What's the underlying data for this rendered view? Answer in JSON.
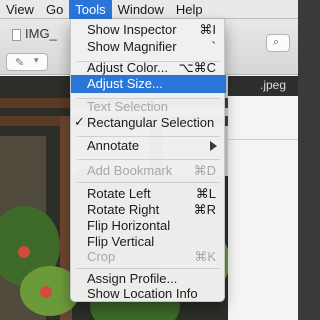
{
  "menubar": {
    "items": [
      "View",
      "Go",
      "Tools",
      "Window",
      "Help"
    ]
  },
  "window": {
    "doc_title": "IMG_",
    "side_tab": ".jpeg"
  },
  "tools_menu": {
    "items": [
      {
        "label": "Show Inspector",
        "shortcut": "⌘I"
      },
      {
        "label": "Show Magnifier",
        "shortcut": "`"
      },
      {
        "label": "Adjust Color...",
        "shortcut": "⌥⌘C"
      },
      {
        "label": "Adjust Size...",
        "shortcut": ""
      },
      {
        "label": "Text Selection",
        "shortcut": ""
      },
      {
        "label": "Rectangular Selection",
        "shortcut": "",
        "check": "✓"
      },
      {
        "label": "Annotate",
        "shortcut": ""
      },
      {
        "label": "Add Bookmark",
        "shortcut": "⌘D"
      },
      {
        "label": "Rotate Left",
        "shortcut": "⌘L"
      },
      {
        "label": "Rotate Right",
        "shortcut": "⌘R"
      },
      {
        "label": "Flip Horizontal",
        "shortcut": ""
      },
      {
        "label": "Flip Vertical",
        "shortcut": ""
      },
      {
        "label": "Crop",
        "shortcut": "⌘K"
      },
      {
        "label": "Assign Profile...",
        "shortcut": ""
      },
      {
        "label": "Show Location Info",
        "shortcut": ""
      }
    ]
  }
}
